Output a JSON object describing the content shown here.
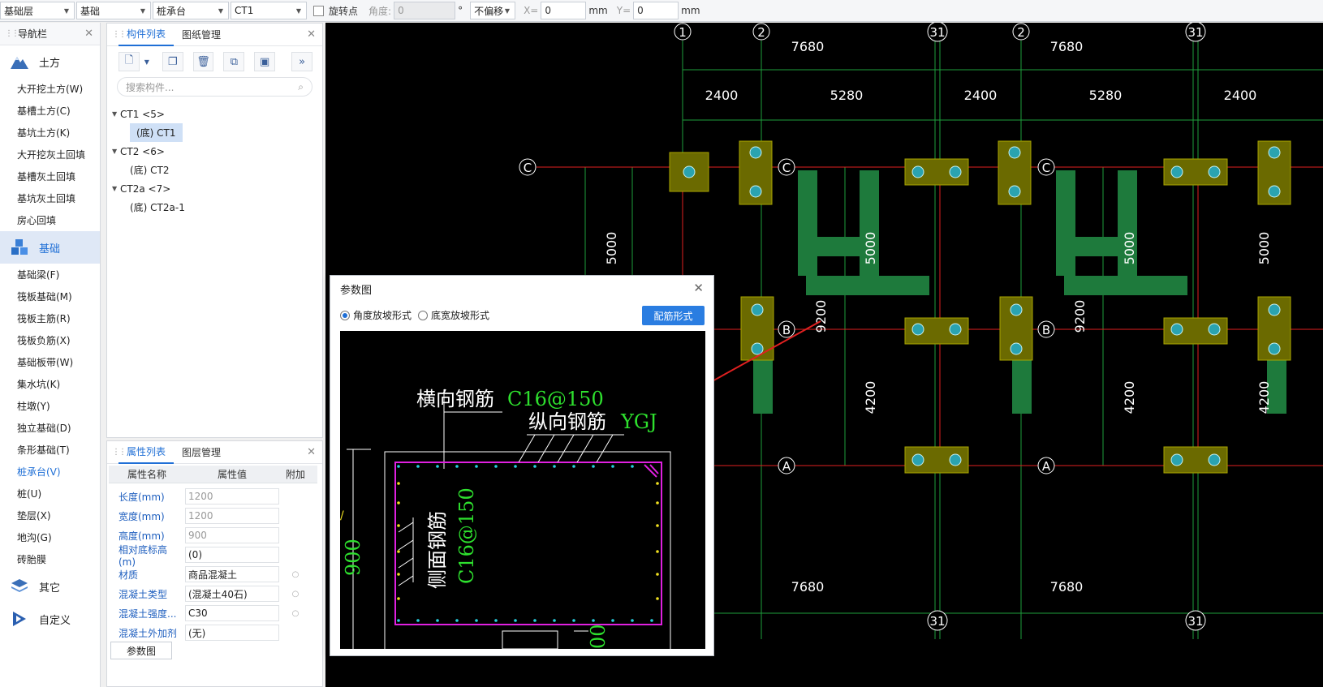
{
  "toolbar": {
    "floor": "基础层",
    "category": "基础",
    "type": "桩承台",
    "component": "CT1",
    "rotate_label": "旋转点",
    "angle_label": "角度:",
    "angle_value": "0",
    "degree_unit": "°",
    "offset": "不偏移",
    "x_label": "X=",
    "x_value": "0",
    "y_label": "Y=",
    "y_value": "0",
    "mm": "mm"
  },
  "nav": {
    "title": "导航栏",
    "categories": [
      {
        "label": "土方",
        "items": [
          "大开挖土方(W)",
          "基槽土方(C)",
          "基坑土方(K)",
          "大开挖灰土回填",
          "基槽灰土回填",
          "基坑灰土回填",
          "房心回填"
        ]
      },
      {
        "label": "基础",
        "items": [
          "基础梁(F)",
          "筏板基础(M)",
          "筏板主筋(R)",
          "筏板负筋(X)",
          "基础板带(W)",
          "集水坑(K)",
          "柱墩(Y)",
          "独立基础(D)",
          "条形基础(T)",
          "桩承台(V)",
          "桩(U)",
          "垫层(X)",
          "地沟(G)",
          "砖胎膜"
        ]
      },
      {
        "label": "其它",
        "items": []
      },
      {
        "label": "自定义",
        "items": []
      }
    ]
  },
  "comp_panel": {
    "tabs": [
      "构件列表",
      "图纸管理"
    ],
    "search_placeholder": "搜索构件...",
    "tree": [
      {
        "label": "CT1 <5>",
        "children": [
          "(底) CT1"
        ]
      },
      {
        "label": "CT2 <6>",
        "children": [
          "(底) CT2"
        ]
      },
      {
        "label": "CT2a <7>",
        "children": [
          "(底) CT2a-1"
        ]
      }
    ]
  },
  "prop_panel": {
    "tabs": [
      "属性列表",
      "图层管理"
    ],
    "headers": [
      "属性名称",
      "属性值",
      "附加"
    ],
    "rows": [
      {
        "name": "长度(mm)",
        "value": "1200"
      },
      {
        "name": "宽度(mm)",
        "value": "1200"
      },
      {
        "name": "高度(mm)",
        "value": "900"
      },
      {
        "name": "相对底标高(m)",
        "value": "(0)"
      },
      {
        "name": "材质",
        "value": "商品混凝土"
      },
      {
        "name": "混凝土类型",
        "value": "(混凝土40石)"
      },
      {
        "name": "混凝土强度...",
        "value": "C30"
      },
      {
        "name": "混凝土外加剂",
        "value": "(无)"
      }
    ],
    "param_button": "参数图"
  },
  "dialog": {
    "title": "参数图",
    "radio1": "角度放坡形式",
    "radio2": "底宽放坡形式",
    "button": "配筋形式",
    "label_h": "横向钢筋",
    "label_h_val": "C16@150",
    "label_l": "纵向钢筋",
    "label_l_val": "YGJ",
    "label_s": "侧面钢筋",
    "label_s_val": "C16@150",
    "dim_900": "900",
    "dim_00": "00"
  },
  "cad": {
    "axis_top": [
      "1",
      "2",
      "31",
      "2",
      "31"
    ],
    "axis_bottom": [
      "31",
      "31"
    ],
    "axis_rows": [
      "C",
      "B",
      "A"
    ],
    "dims_top1": [
      "7680",
      "7680"
    ],
    "dims_top2": [
      "2400",
      "5280",
      "2400",
      "5280",
      "2400"
    ],
    "dims_bottom": [
      "7680",
      "7680"
    ],
    "dims_vert": [
      "5000",
      "5000",
      "5000",
      "5000",
      "9200",
      "9200",
      "4200",
      "4200",
      "4200"
    ]
  },
  "colors": {
    "accent": "#1f6fd6",
    "cad_green": "#1e7a3c",
    "cad_pad": "#6b6a00",
    "cad_red": "#e02020",
    "cad_grid": "#1e9e3c"
  }
}
